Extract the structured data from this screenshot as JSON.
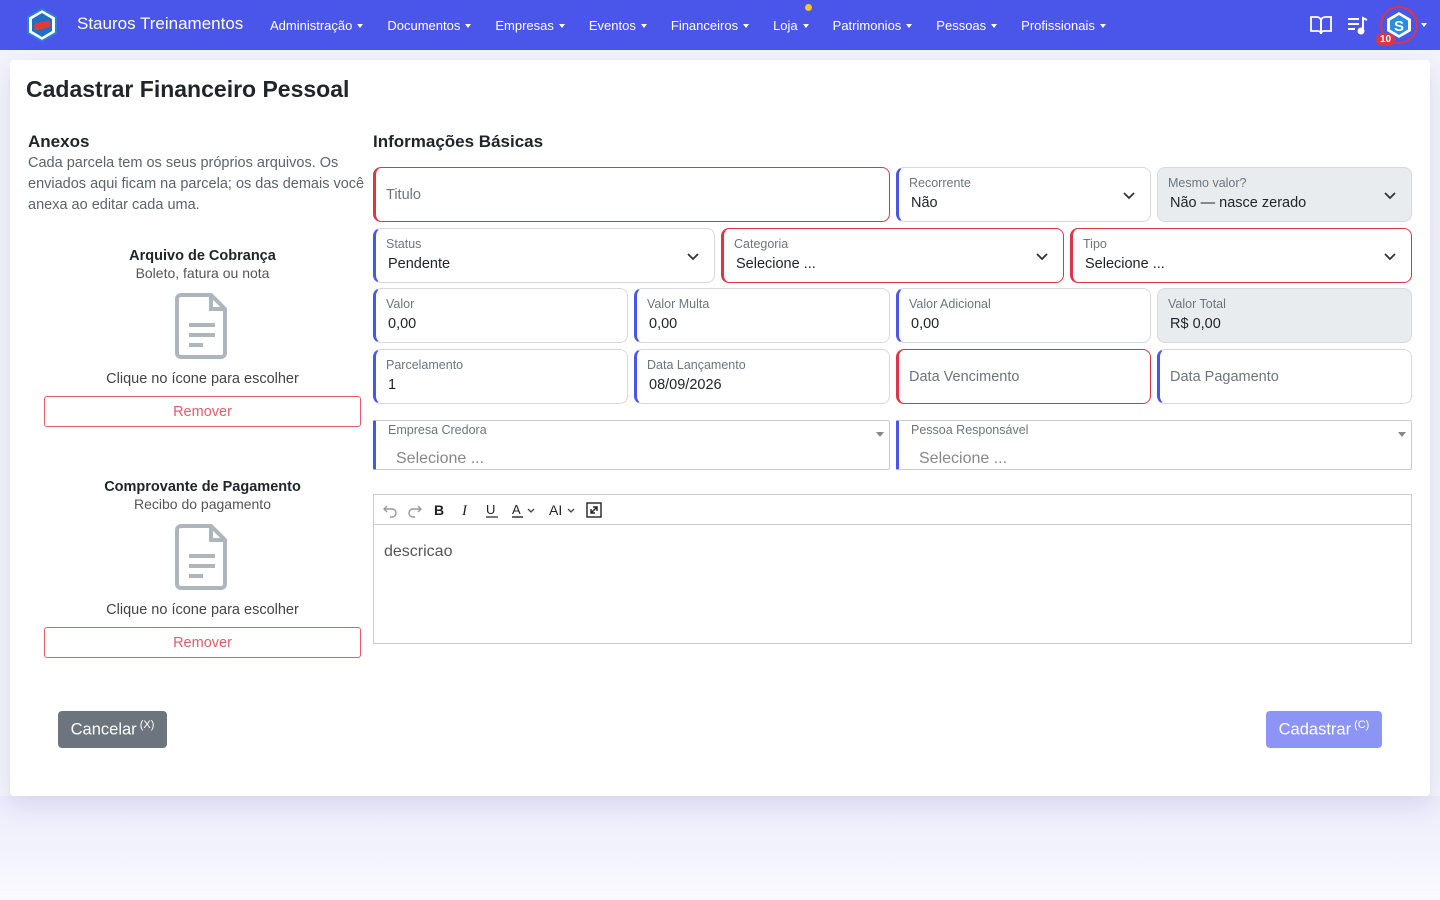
{
  "app": {
    "brand": "Stauros Treinamentos",
    "accent": "#4a55ea",
    "error_color": "#dc3545",
    "notification_count": "10"
  },
  "nav": {
    "items": [
      {
        "label": "Administração"
      },
      {
        "label": "Documentos"
      },
      {
        "label": "Empresas"
      },
      {
        "label": "Eventos"
      },
      {
        "label": "Financeiros"
      },
      {
        "label": "Loja"
      },
      {
        "label": "Patrimonios"
      },
      {
        "label": "Pessoas"
      },
      {
        "label": "Profissionais"
      }
    ],
    "icons": [
      "book-icon",
      "playlist-icon",
      "user-avatar"
    ]
  },
  "page": {
    "title": "Cadastrar Financeiro Pessoal"
  },
  "attachments": {
    "title": "Anexos",
    "description": "Cada parcela tem os seus próprios arquivos. Os enviados aqui ficam na parcela; os das demais você anexa ao editar cada uma.",
    "items": [
      {
        "title": "Arquivo de Cobrança",
        "subtitle": "Boleto, fatura ou nota",
        "hint": "Clique no ícone para escolher",
        "remove_label": "Remover"
      },
      {
        "title": "Comprovante de Pagamento",
        "subtitle": "Recibo do pagamento",
        "hint": "Clique no ícone para escolher",
        "remove_label": "Remover"
      }
    ]
  },
  "form": {
    "section_title": "Informações Básicas",
    "titulo": {
      "placeholder": "Titulo"
    },
    "recorrente": {
      "label": "Recorrente",
      "value": "Não"
    },
    "mesmo_valor": {
      "label": "Mesmo valor?",
      "value": "Não — nasce zerado"
    },
    "status": {
      "label": "Status",
      "value": "Pendente"
    },
    "categoria": {
      "label": "Categoria",
      "value": "Selecione ..."
    },
    "tipo": {
      "label": "Tipo",
      "value": "Selecione ..."
    },
    "valor": {
      "label": "Valor",
      "value": "0,00"
    },
    "valor_multa": {
      "label": "Valor Multa",
      "value": "0,00"
    },
    "valor_adicional": {
      "label": "Valor Adicional",
      "value": "0,00"
    },
    "valor_total": {
      "label": "Valor Total",
      "value": "R$ 0,00"
    },
    "parcelamento": {
      "label": "Parcelamento",
      "value": "1"
    },
    "data_lancamento": {
      "label": "Data Lançamento",
      "value": "08/09/2026"
    },
    "data_vencimento": {
      "placeholder": "Data Vencimento"
    },
    "data_pagamento": {
      "placeholder": "Data Pagamento"
    },
    "empresa_credora": {
      "label": "Empresa Credora",
      "placeholder": "Selecione ..."
    },
    "pessoa_responsavel": {
      "label": "Pessoa Responsável",
      "placeholder": "Selecione ..."
    },
    "descricao": {
      "value": "descricao"
    }
  },
  "actions": {
    "cancel_label": "Cancelar",
    "cancel_shortcut": "(X)",
    "submit_label": "Cadastrar",
    "submit_shortcut": "(C)"
  }
}
